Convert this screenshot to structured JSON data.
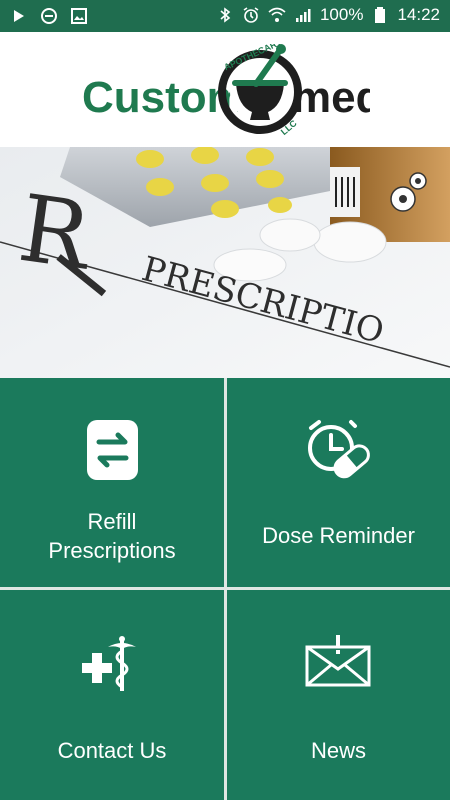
{
  "status_bar": {
    "battery_percent": "100%",
    "time": "14:22",
    "icons": [
      "play-icon",
      "do-not-disturb-icon",
      "image-icon",
      "bluetooth-icon",
      "alarm-icon",
      "wifi-icon",
      "signal-icon",
      "battery-icon"
    ]
  },
  "header": {
    "logo_text_left": "Custom",
    "logo_text_right": "med",
    "logo_arc_top": "APOTHECARY",
    "logo_arc_bottom": "LLC"
  },
  "hero": {
    "image_text_rx": "R",
    "image_text_prescription": "PRESCRIPTIO",
    "settings_icon": "gears-icon"
  },
  "tiles": [
    {
      "label_line1": "Refill",
      "label_line2": "Prescriptions",
      "icon": "refill-swap-icon"
    },
    {
      "label_line1": "Dose Reminder",
      "icon": "alarm-pill-icon"
    },
    {
      "label_line1": "Contact Us",
      "icon": "medical-caduceus-icon"
    },
    {
      "label_line1": "News",
      "icon": "mail-alert-icon"
    }
  ],
  "colors": {
    "status_bar": "#1f6d4f",
    "tile_green": "#1b7a5c",
    "grid_gap": "#dfe7e3",
    "logo_green": "#1f7a4f"
  }
}
